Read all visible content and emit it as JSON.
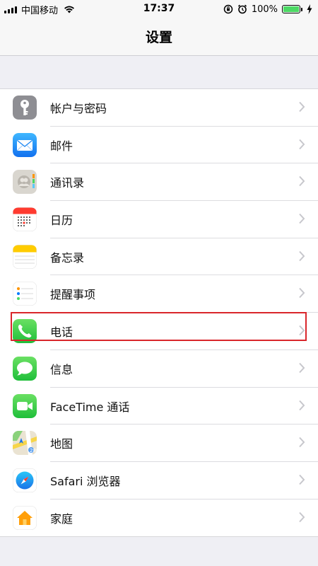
{
  "status_bar": {
    "carrier": "中国移动",
    "time": "17:37",
    "battery_percent": "100%",
    "battery_level": 1.0,
    "icons": [
      "signal-icon",
      "wifi-icon",
      "rotation-lock-icon",
      "alarm-icon",
      "battery-icon",
      "charging-icon"
    ]
  },
  "nav": {
    "title": "设置"
  },
  "settings": {
    "items": [
      {
        "label": "帐户与密码",
        "icon": "key-icon"
      },
      {
        "label": "邮件",
        "icon": "mail-icon"
      },
      {
        "label": "通讯录",
        "icon": "contacts-icon"
      },
      {
        "label": "日历",
        "icon": "calendar-icon"
      },
      {
        "label": "备忘录",
        "icon": "notes-icon"
      },
      {
        "label": "提醒事项",
        "icon": "reminders-icon"
      },
      {
        "label": "电话",
        "icon": "phone-icon"
      },
      {
        "label": "信息",
        "icon": "messages-icon"
      },
      {
        "label": "FaceTime 通话",
        "icon": "facetime-icon"
      },
      {
        "label": "地图",
        "icon": "maps-icon"
      },
      {
        "label": "Safari 浏览器",
        "icon": "safari-icon"
      },
      {
        "label": "家庭",
        "icon": "home-icon"
      }
    ]
  },
  "colors": {
    "highlight": "#d9262b",
    "background": "#efeff4",
    "battery": "#4cd964"
  }
}
